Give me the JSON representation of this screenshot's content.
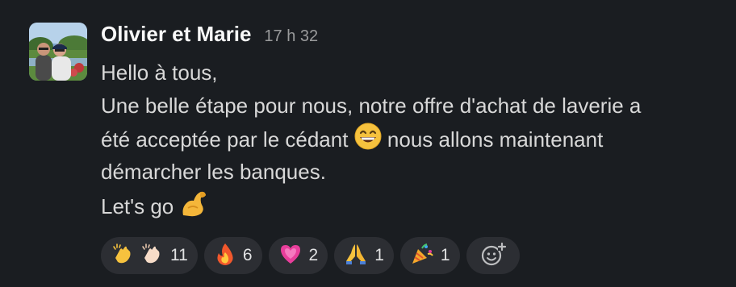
{
  "message": {
    "author": "Olivier et Marie",
    "timestamp": "17 h 32",
    "lines": [
      "Hello à tous,",
      "Une belle étape pour nous, notre offre d'achat de laverie a",
      "été acceptée par le cédant",
      " nous allons maintenant",
      "démarcher les banques.",
      "Let's go"
    ]
  },
  "reactions": [
    {
      "emoji": "clapping-hands",
      "count": "11"
    },
    {
      "emoji": "fire",
      "count": "6"
    },
    {
      "emoji": "growing-heart",
      "count": "2"
    },
    {
      "emoji": "folded-hands",
      "count": "1"
    },
    {
      "emoji": "party-popper",
      "count": "1"
    }
  ],
  "colors": {
    "background": "#1a1d21",
    "reaction_background": "#2c2e33",
    "author": "#f8f8f8",
    "timestamp": "#9a9b9c"
  }
}
